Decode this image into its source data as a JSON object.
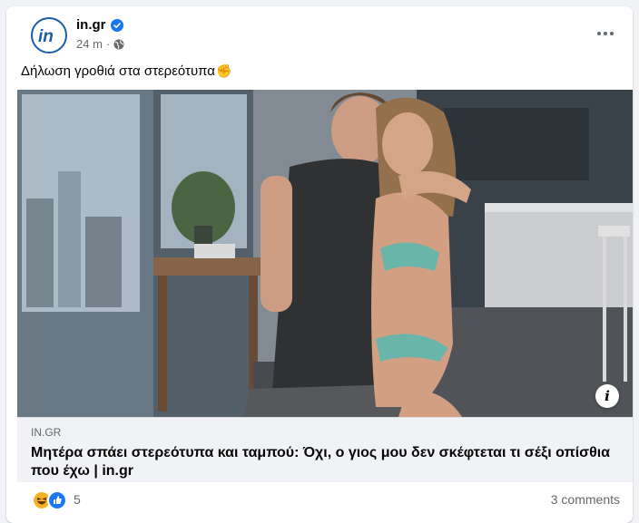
{
  "post": {
    "page_name": "in.gr",
    "time": "24 m",
    "separator": "·",
    "caption": "Δήλωση γροθιά στα στερεότυπα",
    "caption_emoji": "✊"
  },
  "link_preview": {
    "domain": "IN.GR",
    "title": "Μητέρα σπάει στερεότυπα και ταμπού: Όχι, ο γιος μου δεν σκέφτεται τι σέξι οπίσθια που έχω | in.gr",
    "info_label": "i"
  },
  "footer": {
    "reaction_count": "5",
    "comments": "3 comments"
  },
  "icons": [
    "in-logo-icon",
    "verified-badge-icon",
    "globe-icon",
    "more-options-icon",
    "info-icon",
    "haha-reaction-icon",
    "like-reaction-icon"
  ],
  "colors": {
    "brand": "#1b5dab",
    "verified": "#1877f2",
    "like": "#1877f2",
    "haha": "#f7b125"
  }
}
